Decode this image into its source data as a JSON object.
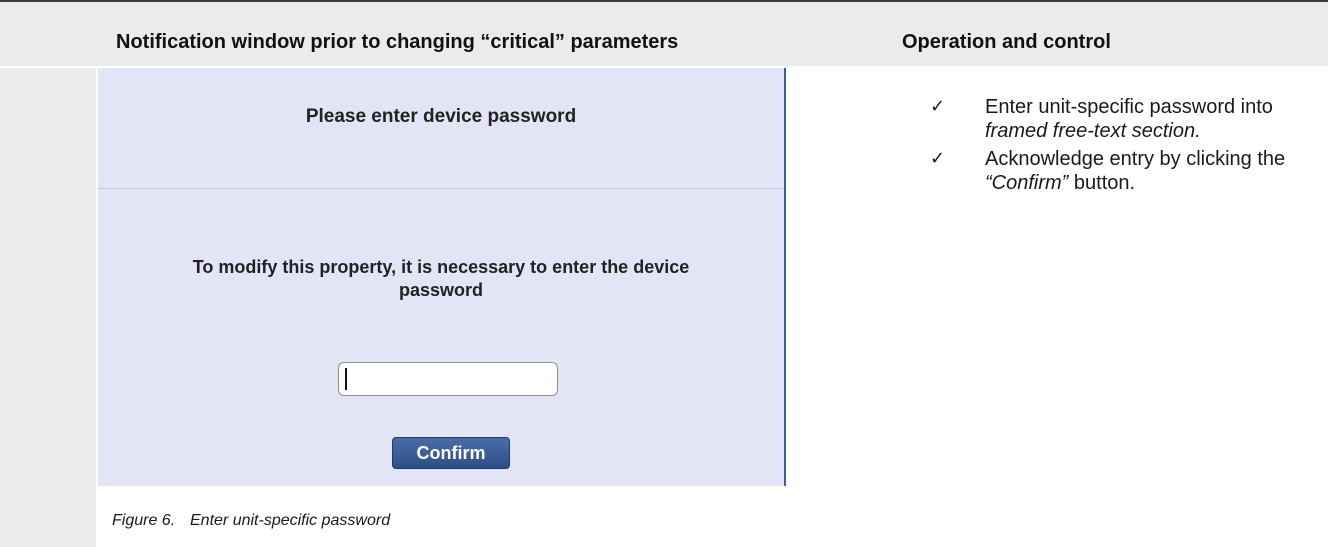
{
  "header": {
    "left_title": "Notification window prior to changing “critical” parameters",
    "right_title": "Operation and control"
  },
  "dialog": {
    "title": "Please enter device password",
    "message_line1": "To modify this property, it is necessary to enter the device",
    "message_line2": "password",
    "password_value": "",
    "confirm_label": "Confirm"
  },
  "figure_caption": {
    "number": "Figure 6.",
    "text": "Enter unit-specific password"
  },
  "instructions": [
    {
      "icon": "check-icon",
      "text_before": "Enter unit-specific password into ",
      "emphasis": "framed free-text section.",
      "text_after": ""
    },
    {
      "icon": "check-icon",
      "text_before": "Acknowledge entry by clicking the ",
      "emphasis": "“Confirm”",
      "text_after": " button."
    }
  ],
  "colors": {
    "header_band": "#ebebed",
    "dialog_background": "#e4e4f7",
    "dialog_border": "#3c5d97",
    "button": "#3a5e99"
  }
}
